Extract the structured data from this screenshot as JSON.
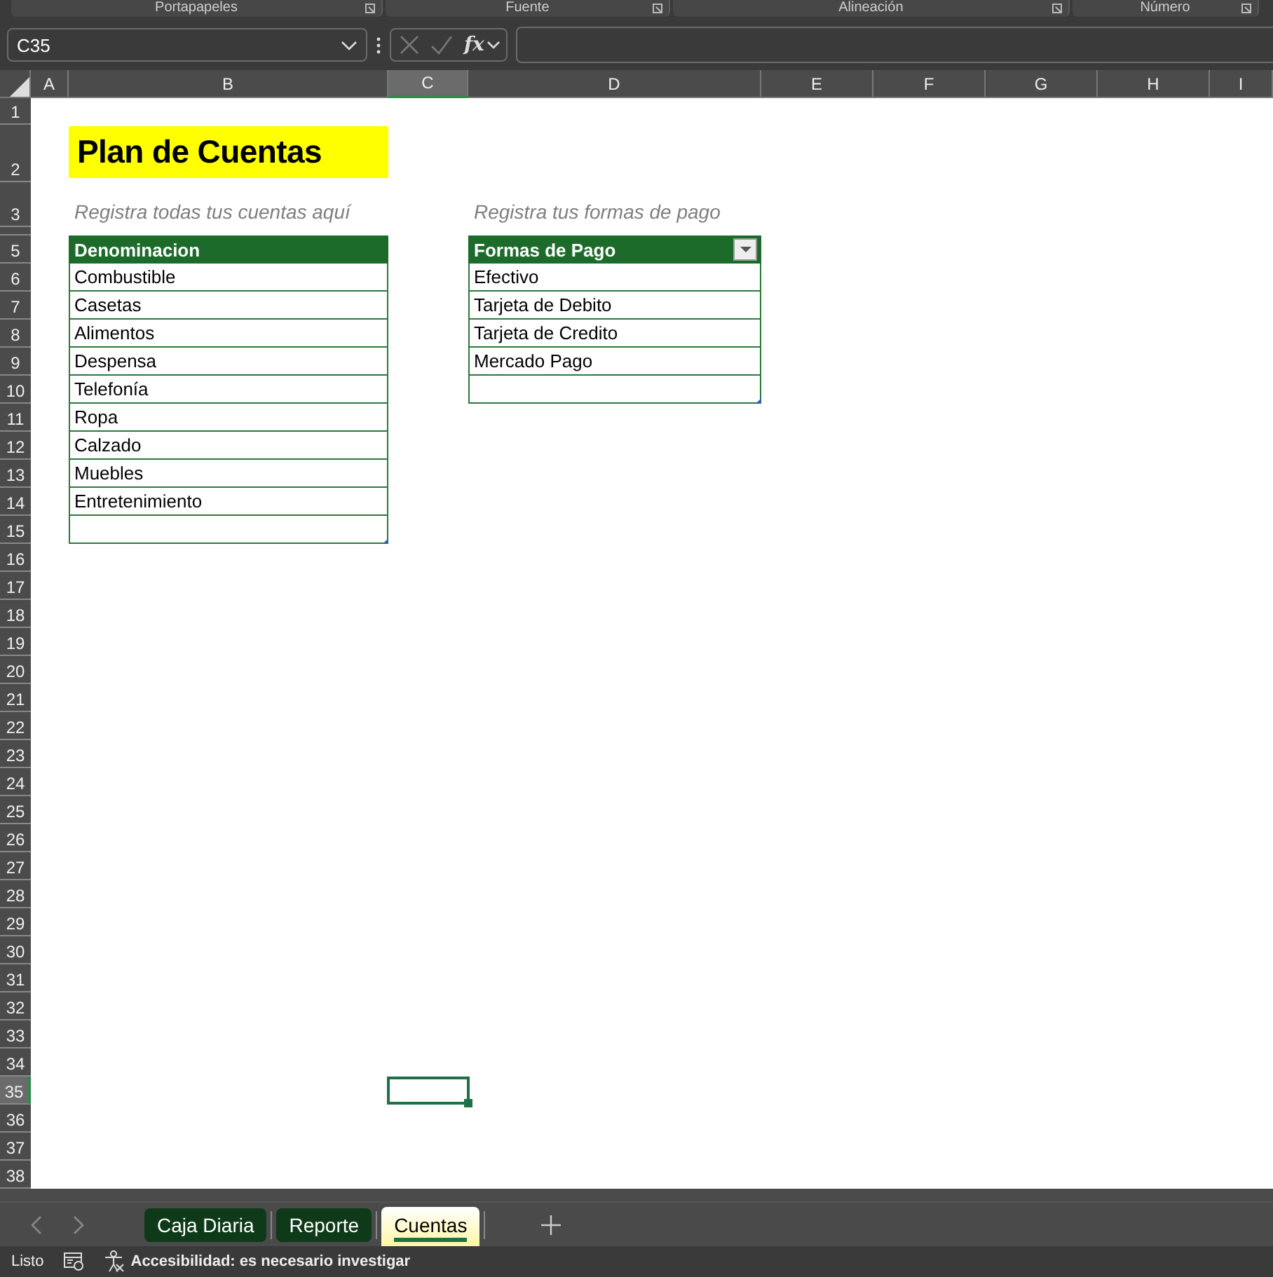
{
  "ribbon_groups": [
    {
      "label": "Portapapeles"
    },
    {
      "label": "Fuente"
    },
    {
      "label": "Alineación"
    },
    {
      "label": "Número"
    }
  ],
  "name_box": {
    "value": "C35"
  },
  "formula_bar": {
    "function_label": "fx"
  },
  "columns": [
    {
      "label": "A",
      "selected": false
    },
    {
      "label": "B",
      "selected": false
    },
    {
      "label": "C",
      "selected": true
    },
    {
      "label": "D",
      "selected": false
    },
    {
      "label": "E",
      "selected": false
    },
    {
      "label": "F",
      "selected": false
    },
    {
      "label": "G",
      "selected": false
    },
    {
      "label": "H",
      "selected": false
    },
    {
      "label": "I",
      "selected": false
    }
  ],
  "rows": [
    {
      "label": "1",
      "selected": false
    },
    {
      "label": "2",
      "selected": false
    },
    {
      "label": "3",
      "selected": false
    },
    {
      "label": "5",
      "selected": false
    },
    {
      "label": "6",
      "selected": false
    },
    {
      "label": "7",
      "selected": false
    },
    {
      "label": "8",
      "selected": false
    },
    {
      "label": "9",
      "selected": false
    },
    {
      "label": "10",
      "selected": false
    },
    {
      "label": "11",
      "selected": false
    },
    {
      "label": "12",
      "selected": false
    },
    {
      "label": "13",
      "selected": false
    },
    {
      "label": "14",
      "selected": false
    },
    {
      "label": "15",
      "selected": false
    },
    {
      "label": "16",
      "selected": false
    },
    {
      "label": "17",
      "selected": false
    },
    {
      "label": "18",
      "selected": false
    },
    {
      "label": "19",
      "selected": false
    },
    {
      "label": "20",
      "selected": false
    },
    {
      "label": "21",
      "selected": false
    },
    {
      "label": "22",
      "selected": false
    },
    {
      "label": "23",
      "selected": false
    },
    {
      "label": "24",
      "selected": false
    },
    {
      "label": "25",
      "selected": false
    },
    {
      "label": "26",
      "selected": false
    },
    {
      "label": "27",
      "selected": false
    },
    {
      "label": "28",
      "selected": false
    },
    {
      "label": "29",
      "selected": false
    },
    {
      "label": "30",
      "selected": false
    },
    {
      "label": "31",
      "selected": false
    },
    {
      "label": "32",
      "selected": false
    },
    {
      "label": "33",
      "selected": false
    },
    {
      "label": "34",
      "selected": false
    },
    {
      "label": "35",
      "selected": true
    },
    {
      "label": "36",
      "selected": false
    },
    {
      "label": "37",
      "selected": false
    },
    {
      "label": "38",
      "selected": false
    }
  ],
  "title": "Plan de Cuentas",
  "notes": [
    "Registra todas tus cuentas aquí",
    "Registra tus formas de pago"
  ],
  "tables": [
    {
      "header": "Denominacion",
      "filter_button": false,
      "items": [
        "Combustible",
        "Casetas",
        "Alimentos",
        "Despensa",
        "Telefonía",
        "Ropa",
        "Calzado",
        "Muebles",
        "Entretenimiento"
      ]
    },
    {
      "header": "Formas de Pago",
      "filter_button": true,
      "items": [
        "Efectivo",
        "Tarjeta de Debito",
        "Tarjeta de Credito",
        "Mercado Pago"
      ]
    }
  ],
  "sheet_tabs": [
    {
      "label": "Caja Diaria",
      "selected": false,
      "color": "#0f3a19"
    },
    {
      "label": "Reporte",
      "selected": false,
      "color": "#0f3a19"
    },
    {
      "label": "Cuentas",
      "selected": true,
      "color": "#fff6a0"
    }
  ],
  "status_bar": {
    "mode": "Listo",
    "accessibility": "Accesibilidad: es necesario investigar"
  }
}
